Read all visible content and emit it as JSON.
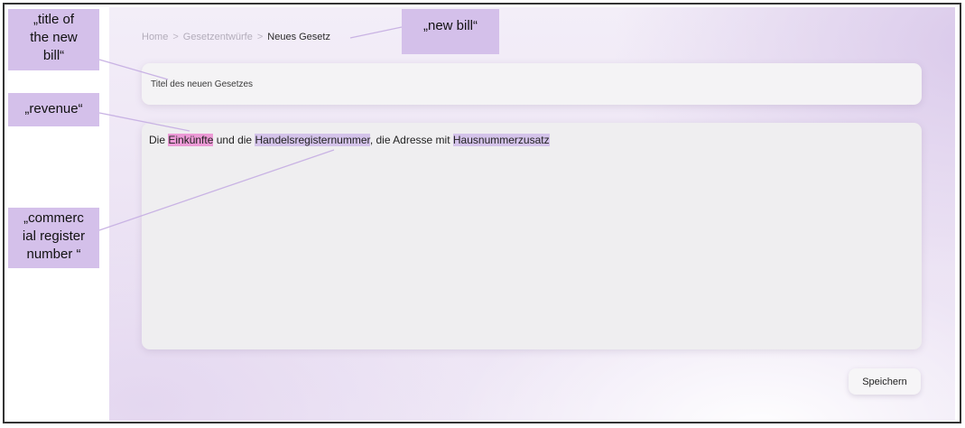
{
  "breadcrumb": {
    "items": [
      "Home",
      "Gesetzentwürfe",
      "Neues Gesetz"
    ],
    "separator": ">"
  },
  "form": {
    "title_placeholder": "Titel des neuen Gesetzes",
    "body": {
      "segments": [
        "Die ",
        "Einkünfte",
        " und die ",
        "Handelsregisternummer",
        ", die Adresse mit ",
        "Hausnummerzusatz"
      ]
    },
    "save_label": "Speichern"
  },
  "annotations": {
    "title": [
      "„title of",
      "the new",
      "bill“"
    ],
    "new_bill": "„new bill“",
    "revenue": "„revenue“",
    "commercial": [
      "„commerc",
      "ial register",
      "number “"
    ]
  },
  "colors": {
    "highlight_pink": "#ec9ad6",
    "highlight_lavender": "#d4c3ea",
    "annotation_box": "#d4c0ea",
    "connector_line": "#c9b3e4"
  }
}
